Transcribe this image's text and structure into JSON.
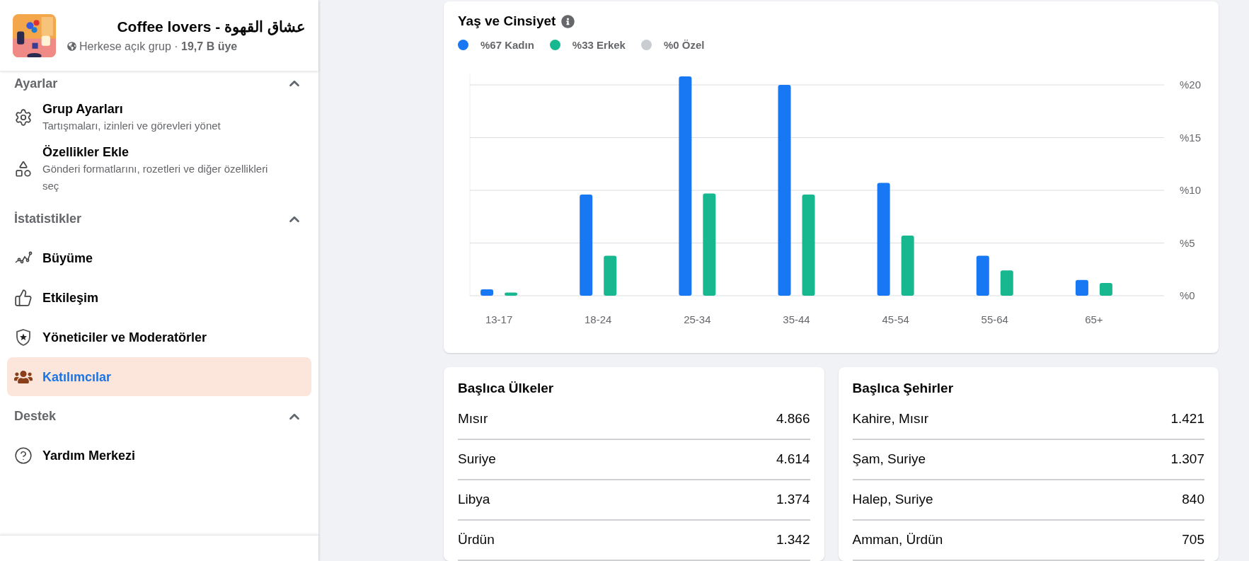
{
  "group": {
    "name": "Coffee lovers - عشاق القهوة",
    "meta": "Herkese açık grup · **19,7 B üye**"
  },
  "sidebar": {
    "sections": [
      {
        "title": "Ayarlar",
        "expanded": true,
        "items": [
          {
            "label": "Grup Ayarları",
            "description": "Tartışmaları, izinleri ve görevleri yönet",
            "selected": false
          },
          {
            "label": "Özellikler Ekle",
            "description": "Gönderi formatlarını, rozetleri ve diğer özellikleri seç",
            "selected": false
          }
        ]
      },
      {
        "title": "İstatistikler",
        "expanded": true,
        "items": [
          {
            "label": "Büyüme",
            "selected": false
          },
          {
            "label": "Etkileşim",
            "selected": false
          },
          {
            "label": "Yöneticiler ve Moderatörler",
            "selected": false
          },
          {
            "label": "Katılımcılar",
            "selected": true
          }
        ]
      },
      {
        "title": "Destek",
        "expanded": true,
        "items": [
          {
            "label": "Yardım Merkezi",
            "selected": false
          }
        ]
      }
    ]
  },
  "age_gender": {
    "title": "Yaş ve Cinsiyet",
    "legend": [
      {
        "label": "%67 Kadın",
        "color": "#1877f2"
      },
      {
        "label": "%33 Erkek",
        "color": "#17b890"
      },
      {
        "label": "%0 Özel",
        "color": "#c9ccd1"
      }
    ],
    "chart_data": {
      "type": "bar",
      "categories": [
        "13-17",
        "18-24",
        "25-34",
        "35-44",
        "45-54",
        "55-64",
        "65+"
      ],
      "series": [
        {
          "color": "#1877f2",
          "values": [
            0.6,
            9.6,
            20.8,
            20.0,
            10.7,
            3.8,
            1.5
          ]
        },
        {
          "color": "#17b890",
          "values": [
            0.3,
            3.8,
            9.7,
            9.6,
            5.7,
            2.4,
            1.2
          ]
        }
      ],
      "ylim": [
        0,
        21
      ],
      "grid": true,
      "yticks": [
        {
          "value": 0,
          "label": "%0"
        },
        {
          "value": 5,
          "label": "%5"
        },
        {
          "value": 10,
          "label": "%10"
        },
        {
          "value": 15,
          "label": "%15"
        },
        {
          "value": 20,
          "label": "%20"
        }
      ]
    }
  },
  "top_countries": {
    "title": "Başlıca Ülkeler",
    "rows": [
      {
        "name": "Mısır",
        "count": "4.866"
      },
      {
        "name": "Suriye",
        "count": "4.614"
      },
      {
        "name": "Libya",
        "count": "1.374"
      },
      {
        "name": "Ürdün",
        "count": "1.342"
      }
    ]
  },
  "top_cities": {
    "title": "Başlıca Şehirler",
    "rows": [
      {
        "name": "Kahire, Mısır",
        "count": "1.421"
      },
      {
        "name": "Şam, Suriye",
        "count": "1.307"
      },
      {
        "name": "Halep, Suriye",
        "count": "840"
      },
      {
        "name": "Amman, Ürdün",
        "count": "705"
      }
    ]
  }
}
